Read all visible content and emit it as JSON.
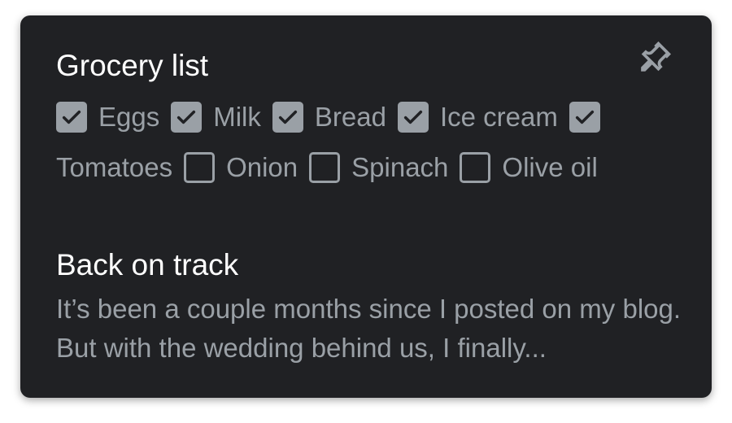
{
  "card1": {
    "title": "Grocery list",
    "pin_icon": "pin-icon",
    "items": [
      {
        "label": "Eggs",
        "checked": true
      },
      {
        "label": "Milk",
        "checked": true
      },
      {
        "label": "Bread",
        "checked": true
      },
      {
        "label": "Ice cream",
        "checked": true
      },
      {
        "label": "Tomatoes",
        "checked": true
      },
      {
        "label": "Onion",
        "checked": false
      },
      {
        "label": "Spinach",
        "checked": false
      },
      {
        "label": "Olive oil",
        "checked": false
      }
    ]
  },
  "card2": {
    "title": "Back on track",
    "body": "It’s been a couple months since I posted on my blog. But with the wedding behind us, I finally..."
  },
  "colors": {
    "card_bg": "#202124",
    "title": "#ffffff",
    "muted": "#9aa0a6"
  }
}
